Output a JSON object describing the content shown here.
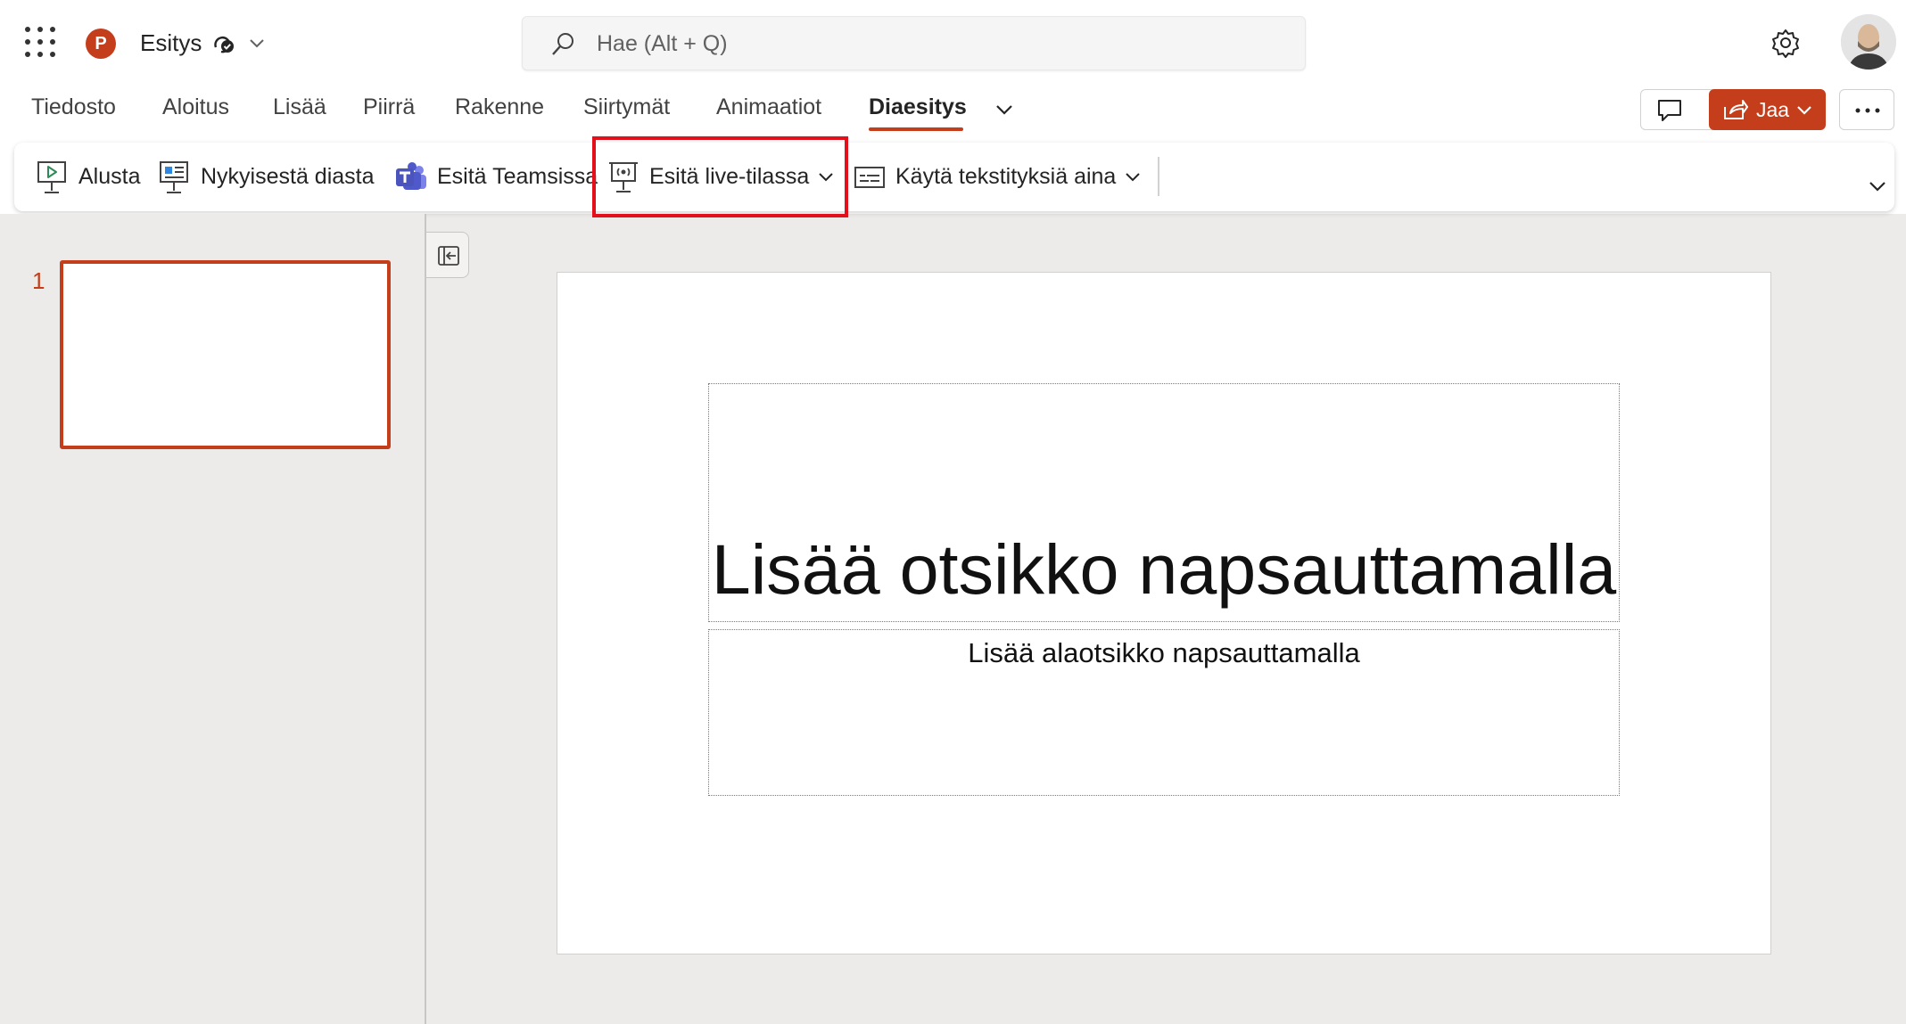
{
  "app": {
    "doc_title": "Esitys",
    "brand_color": "#c43e1c"
  },
  "search": {
    "placeholder": "Hae (Alt + Q)"
  },
  "tabs": [
    {
      "label": "Tiedosto"
    },
    {
      "label": "Aloitus"
    },
    {
      "label": "Lisää"
    },
    {
      "label": "Piirrä"
    },
    {
      "label": "Rakenne"
    },
    {
      "label": "Siirtymät"
    },
    {
      "label": "Animaatiot"
    },
    {
      "label": "Diaesitys",
      "active": true
    }
  ],
  "header_actions": {
    "share_label": "Jaa"
  },
  "toolbar": {
    "from_beginning": "Alusta",
    "from_current": "Nykyisestä diasta",
    "present_teams": "Esitä Teamsissa",
    "present_live": "Esitä live-tilassa",
    "captions": "Käytä tekstityksiä aina"
  },
  "thumbnails": [
    {
      "number": "1"
    }
  ],
  "slide": {
    "title_placeholder": "Lisää otsikko napsauttamalla",
    "subtitle_placeholder": "Lisää alaotsikko napsauttamalla"
  },
  "icons": {
    "app_launcher": "waffle-icon",
    "search": "search-icon",
    "settings": "gear-icon",
    "comment": "comment-icon",
    "share": "share-icon",
    "more": "more-icon"
  }
}
